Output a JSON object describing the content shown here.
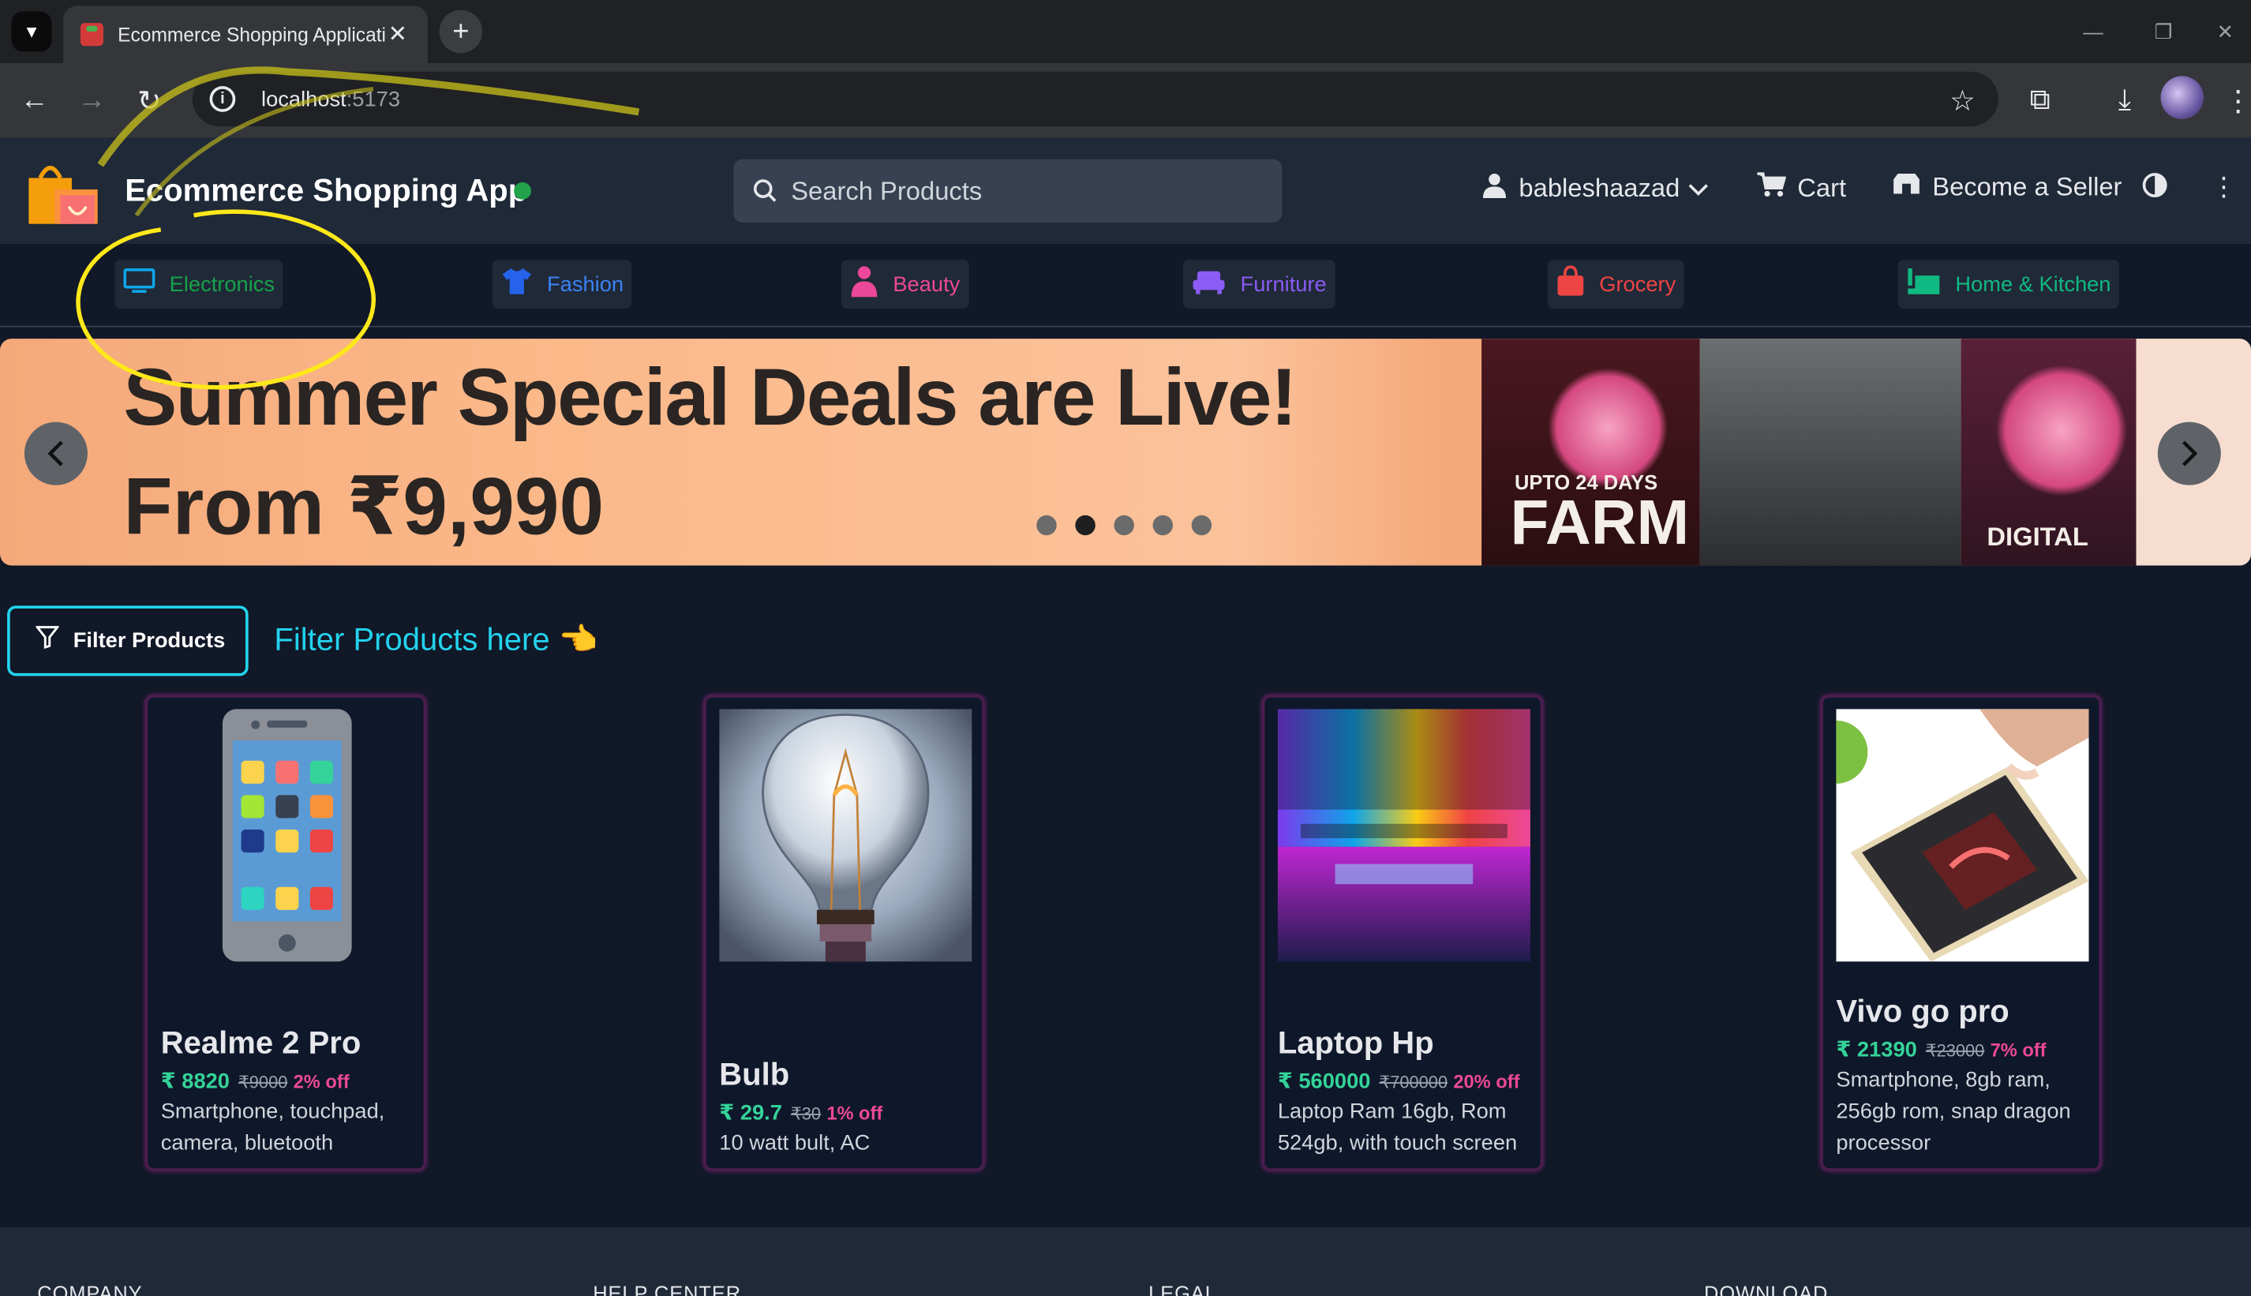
{
  "browser": {
    "tab_title": "Ecommerce Shopping Applicati",
    "url_host": "localhost",
    "url_port": ":5173"
  },
  "header": {
    "brand": "Ecommerce Shopping App",
    "search_placeholder": "Search Products",
    "user": "bableshaazad",
    "cart": "Cart",
    "seller": "Become a Seller"
  },
  "categories": [
    {
      "label": "Electronics",
      "color": "#16a34a",
      "icon": "monitor-icon",
      "icon_color": "#0ea5e9"
    },
    {
      "label": "Fashion",
      "color": "#3b82f6",
      "icon": "tshirt-icon",
      "icon_color": "#2563eb"
    },
    {
      "label": "Beauty",
      "color": "#ec4899",
      "icon": "person-icon",
      "icon_color": "#ec4899"
    },
    {
      "label": "Furniture",
      "color": "#8b5cf6",
      "icon": "sofa-icon",
      "icon_color": "#8b5cf6"
    },
    {
      "label": "Grocery",
      "color": "#ef4444",
      "icon": "bag-icon",
      "icon_color": "#ef4444"
    },
    {
      "label": "Home & Kitchen",
      "color": "#10b981",
      "icon": "kitchen-icon",
      "icon_color": "#10b981"
    }
  ],
  "banner": {
    "line1": "Summer Special Deals are Live!",
    "line2": "From ₹9,990",
    "upto": "UPTO 24 DAYS",
    "farm": "FARM",
    "digital": "DIGITAL",
    "active_slide": 2,
    "slide_count": 5
  },
  "filter": {
    "button": "Filter Products",
    "hint": "Filter Products here",
    "hint_emoji": "👈"
  },
  "products": [
    {
      "name": "Realme 2 Pro",
      "price": "₹ 8820",
      "mrp": "₹9000",
      "off": "2% off",
      "desc": "Smartphone, touchpad, camera, bluetooth"
    },
    {
      "name": "Bulb",
      "price": "₹ 29.7",
      "mrp": "₹30",
      "off": "1% off",
      "desc": "10 watt bult, AC"
    },
    {
      "name": "Laptop Hp",
      "price": "₹ 560000",
      "mrp": "₹700000",
      "off": "20% off",
      "desc": "Laptop Ram 16gb, Rom 524gb, with touch screen"
    },
    {
      "name": "Vivo go pro",
      "price": "₹ 21390",
      "mrp": "₹23000",
      "off": "7% off",
      "desc": "Smartphone, 8gb ram, 256gb rom, snap dragon processor"
    }
  ],
  "footer": {
    "cols": [
      "COMPANY",
      "HELP CENTER",
      "LEGAL",
      "DOWNLOAD"
    ]
  }
}
